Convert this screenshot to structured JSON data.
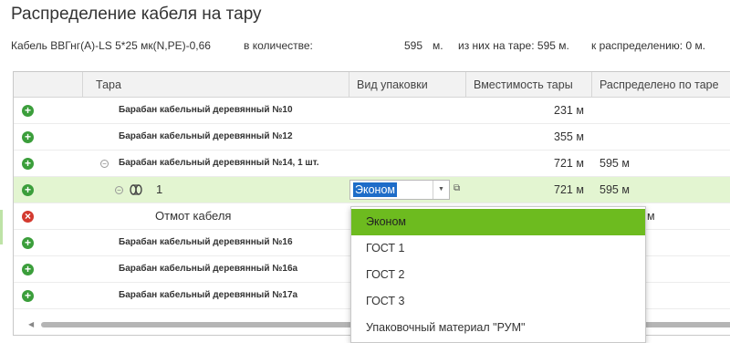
{
  "title": "Распределение кабеля на тару",
  "info": {
    "cable_name": "Кабель ВВГнг(А)-LS 5*25 мк(N,PE)-0,66",
    "qty_label": "в количестве:",
    "qty_value": "595",
    "qty_unit": "м.",
    "on_tare": "из них на таре: 595 м.",
    "to_distribute": "к распределению: 0 м."
  },
  "columns": [
    "Тара",
    "Вид упаковки",
    "Вместимость тары",
    "Распределено по таре"
  ],
  "rows": [
    {
      "icon": "plus",
      "name": "Барабан кабельный деревянный №10",
      "capacity": "231 м",
      "distributed": ""
    },
    {
      "icon": "plus",
      "name": "Барабан кабельный деревянный №12",
      "capacity": "355 м",
      "distributed": ""
    },
    {
      "icon": "plus",
      "name": "Барабан кабельный деревянный №14, 1 шт.",
      "capacity": "721 м",
      "distributed": "595 м"
    },
    {
      "icon": "plus",
      "name": "1",
      "packaging": "Эконом",
      "capacity": "721 м",
      "distributed": "595 м"
    },
    {
      "icon": "minus",
      "name": "Отмот кабеля",
      "capacity": "",
      "distributed": "м"
    },
    {
      "icon": "plus",
      "name": "Барабан кабельный деревянный №16",
      "capacity": "",
      "distributed": ""
    },
    {
      "icon": "plus",
      "name": "Барабан кабельный деревянный №16а",
      "capacity": "",
      "distributed": ""
    },
    {
      "icon": "plus",
      "name": "Барабан кабельный деревянный №17а",
      "capacity": "",
      "distributed": ""
    }
  ],
  "dropdown_options": [
    "Эконом",
    "ГОСТ 1",
    "ГОСТ 2",
    "ГОСТ 3",
    "Упаковочный материал \"РУМ\""
  ],
  "selected_option": "Эконом",
  "colors": {
    "plus": "#3b9e3b",
    "minus": "#d33a2f",
    "selected_row": "#e3f5d1",
    "active_option": "#6dbb1f",
    "highlight": "#1e6cc8"
  }
}
